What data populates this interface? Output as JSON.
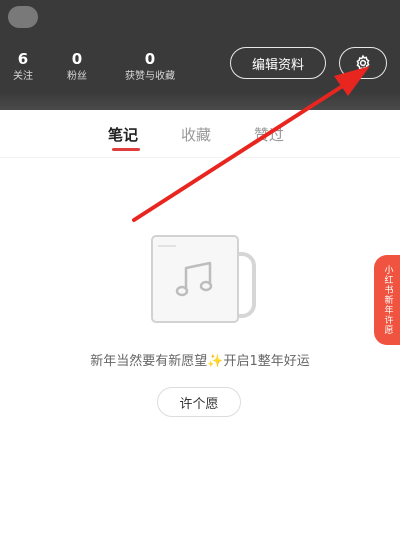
{
  "profile": {
    "stats": [
      {
        "value": "6",
        "label": "关注"
      },
      {
        "value": "0",
        "label": "粉丝"
      },
      {
        "value": "0",
        "label": "获赞与收藏"
      }
    ],
    "edit_profile_label": "编辑资料"
  },
  "tabs": [
    {
      "label": "笔记",
      "active": true
    },
    {
      "label": "收藏",
      "active": false
    },
    {
      "label": "赞过",
      "active": false
    }
  ],
  "empty_state": {
    "message": "新年当然要有新愿望✨开启1整年好运",
    "button_label": "许个愿"
  },
  "side_tag": {
    "label": "小红书新年许愿"
  },
  "colors": {
    "header_bg": "#3a3a3a",
    "accent": "#e03c3c",
    "side_tag": "#f0533f",
    "annotation_arrow": "#e8261f"
  },
  "icons": {
    "settings": "gear-icon",
    "empty": "music-note-icon"
  }
}
